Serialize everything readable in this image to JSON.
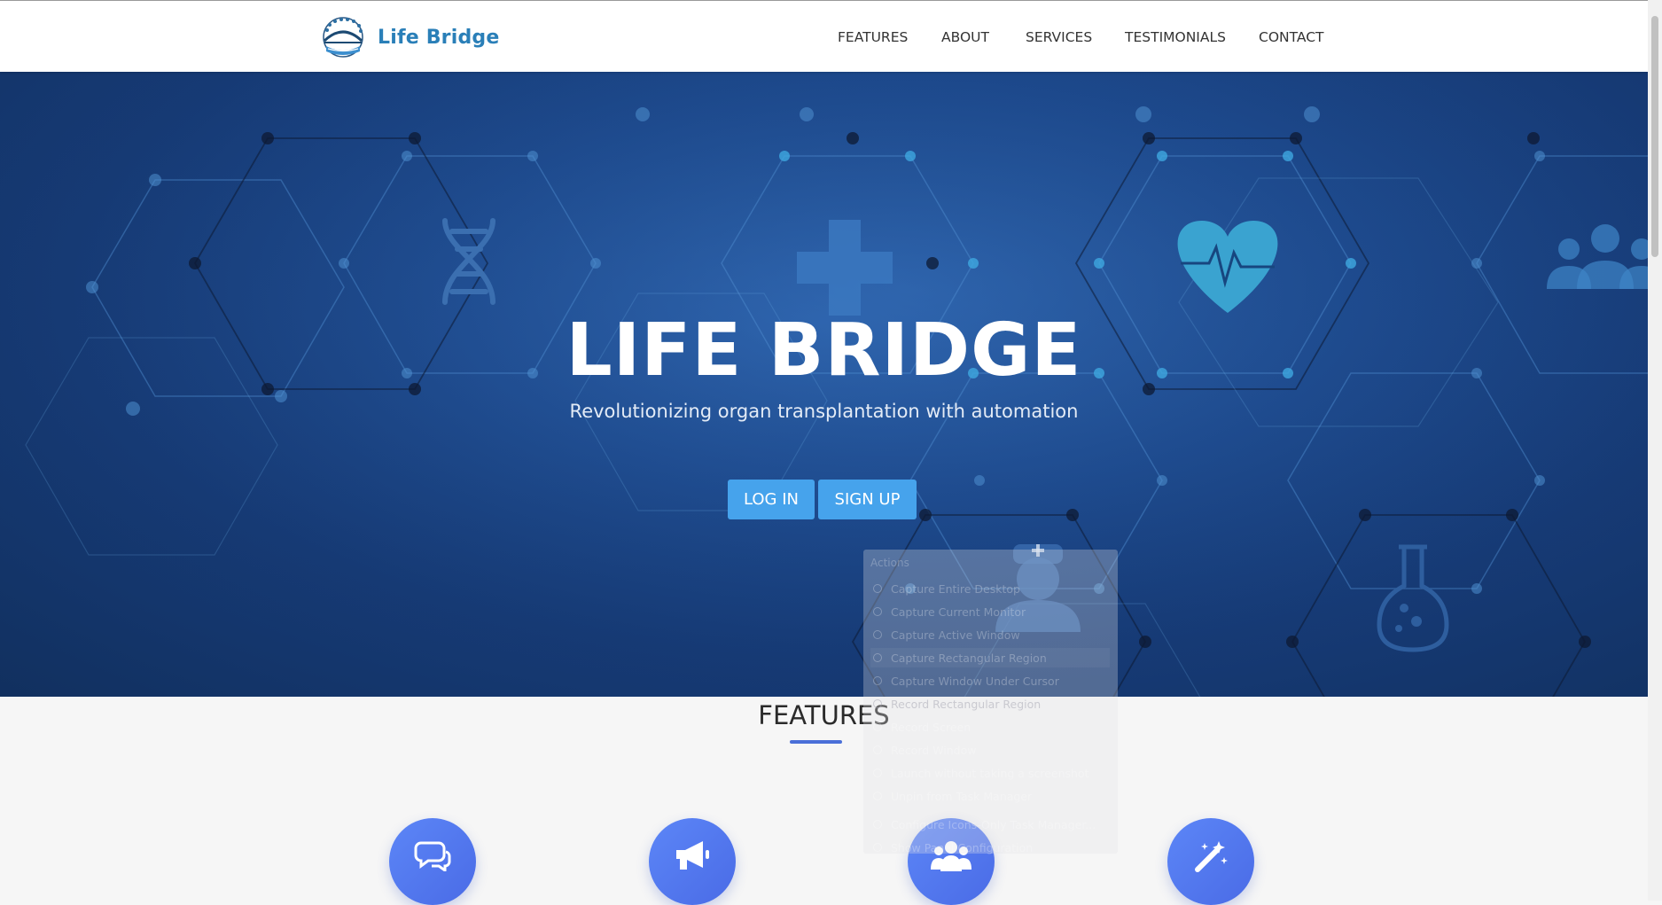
{
  "nav": {
    "brand": "Life Bridge",
    "links": [
      "FEATURES",
      "ABOUT",
      "SERVICES",
      "TESTIMONIALS",
      "CONTACT"
    ]
  },
  "hero": {
    "title": "LIFE BRIDGE",
    "subtitle": "Revolutionizing organ transplantation with automation",
    "login_label": "LOG IN",
    "signup_label": "SIGN UP"
  },
  "features": {
    "title": "FEATURES",
    "icons": [
      "chat-icon",
      "megaphone-icon",
      "users-icon",
      "magic-wand-icon"
    ]
  },
  "context_menu": {
    "header": "Actions",
    "items": [
      "Capture Entire Desktop",
      "Capture Current Monitor",
      "Capture Active Window",
      "Capture Rectangular Region",
      "Capture Window Under Cursor",
      "Record Rectangular Region",
      "Record Screen",
      "Record Window",
      "Launch without taking a screenshot",
      "Unpin from Task Manager",
      "Configure Icons-Only Task Manager...",
      "Show Panel Configuration"
    ]
  },
  "colors": {
    "brand": "#2a7fb8",
    "hero_bg": "#1d4a8f",
    "button": "#46a3ec",
    "feature_accent": "#4a6fd8"
  }
}
